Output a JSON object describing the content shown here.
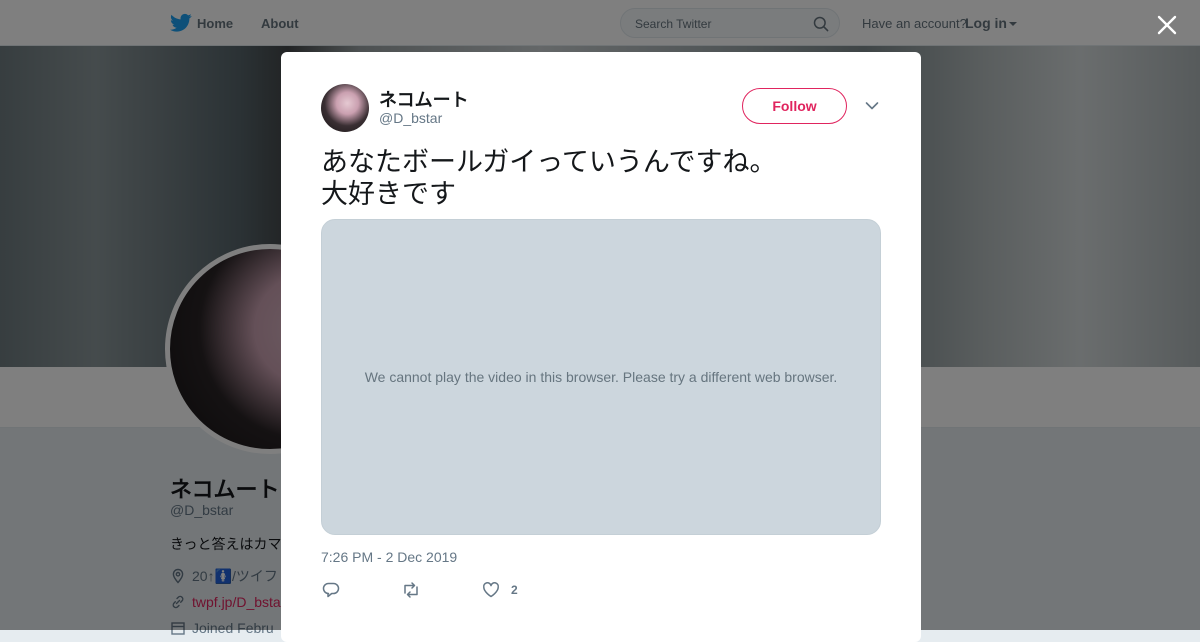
{
  "topbar": {
    "home_label": "Home",
    "about_label": "About",
    "search_placeholder": "Search Twitter",
    "account_question": "Have an account?",
    "login_label": "Log in"
  },
  "profile": {
    "name": "ネコムート",
    "handle": "@D_bstar",
    "bio": "きっと答えはカマ",
    "location": "20↑🚺/ツイフ",
    "url": "twpf.jp/D_bsta",
    "joined": "Joined Febru"
  },
  "tweet": {
    "display_name": "ネコムート",
    "handle": "@D_bstar",
    "follow_label": "Follow",
    "text": "あなたボールガイっていうんですね。\n大好きです",
    "video_message": "We cannot play the video in this browser. Please try a different web browser.",
    "timestamp": "7:26 PM - 2 Dec 2019",
    "like_count": "2"
  },
  "colors": {
    "accent": "#e0245e",
    "twitter_blue": "#1da1f2",
    "muted": "#657786",
    "video_bg": "#ccd6dd"
  },
  "icons": [
    "twitter-bird-icon",
    "search-icon",
    "close-icon",
    "chevron-down-icon",
    "reply-icon",
    "retweet-icon",
    "heart-icon",
    "location-icon",
    "link-icon",
    "calendar-icon"
  ]
}
